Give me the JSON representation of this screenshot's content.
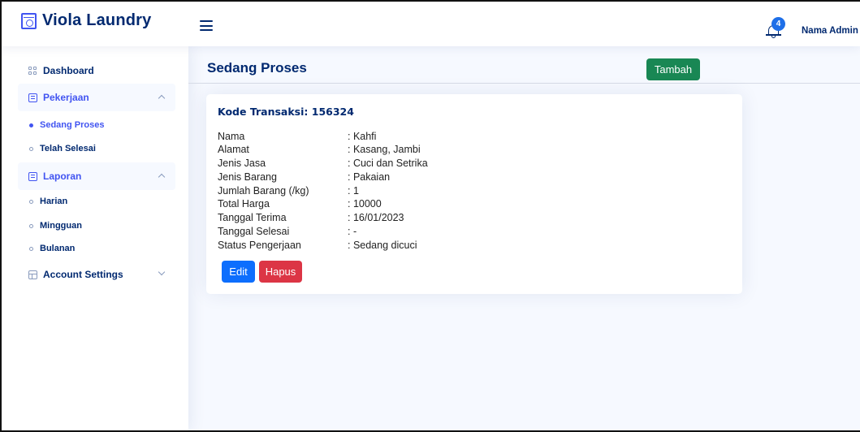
{
  "header": {
    "brand": "Viola Laundry",
    "notification_count": "4",
    "admin_name": "Nama Admin"
  },
  "sidebar": {
    "items": [
      {
        "label": "Dashboard",
        "icon": "grid-icon"
      },
      {
        "label": "Pekerjaan",
        "icon": "document-icon",
        "expanded": true,
        "children": [
          {
            "label": "Sedang Proses",
            "active": true
          },
          {
            "label": "Telah Selesai"
          }
        ]
      },
      {
        "label": "Laporan",
        "icon": "document-icon",
        "expanded": true,
        "children": [
          {
            "label": "Harian"
          },
          {
            "label": "Mingguan"
          },
          {
            "label": "Bulanan"
          }
        ]
      },
      {
        "label": "Account Settings",
        "icon": "layout-icon",
        "expanded": false
      }
    ]
  },
  "main": {
    "page_title": "Sedang Proses",
    "add_button": "Tambah",
    "card": {
      "title": "Kode Transaksi: 156324",
      "rows": [
        {
          "label": "Nama",
          "value": ": Kahfi"
        },
        {
          "label": "Alamat",
          "value": ": Kasang, Jambi"
        },
        {
          "label": "Jenis Jasa",
          "value": ": Cuci dan Setrika"
        },
        {
          "label": "Jenis Barang",
          "value": ": Pakaian"
        },
        {
          "label": "Jumlah Barang (/kg)",
          "value": ": 1"
        },
        {
          "label": "Total Harga",
          "value": ": 10000"
        },
        {
          "label": "Tanggal Terima",
          "value": ": 16/01/2023"
        },
        {
          "label": "Tanggal Selesai",
          "value": ": -"
        },
        {
          "label": "Status Pengerjaan",
          "value": ": Sedang dicuci"
        }
      ],
      "edit_button": "Edit",
      "delete_button": "Hapus"
    }
  },
  "colors": {
    "brand_text": "#012970",
    "accent": "#4154f1",
    "success": "#198754",
    "primary": "#0d6efd",
    "danger": "#dc3545",
    "background": "#f6f9ff"
  }
}
